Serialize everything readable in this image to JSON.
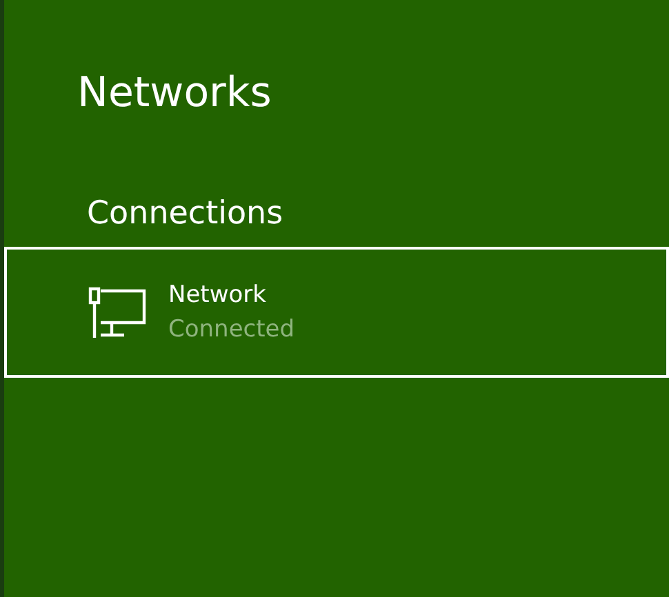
{
  "title": "Networks",
  "section": {
    "heading": "Connections",
    "items": [
      {
        "name": "Network",
        "status": "Connected",
        "selected": true
      }
    ]
  }
}
